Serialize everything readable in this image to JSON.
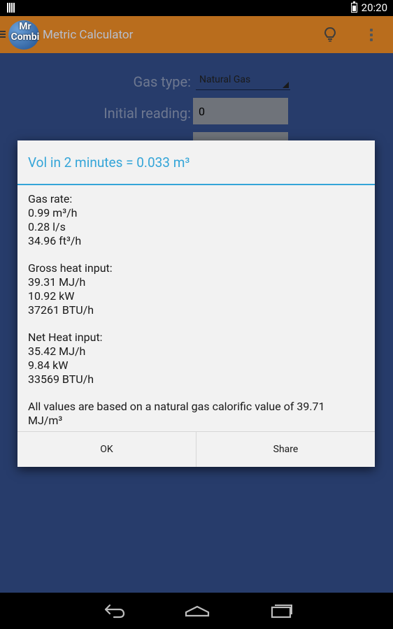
{
  "status": {
    "time": "20:20"
  },
  "app": {
    "title": "Metric Calculator",
    "logo_text_top": "Mr",
    "logo_text_bottom": "Combi"
  },
  "form": {
    "gas_type_label": "Gas type:",
    "gas_type_value": "Natural Gas",
    "initial_reading_label": "Initial reading:",
    "initial_reading_value": "0"
  },
  "dialog": {
    "title": "Vol in 2 minutes = 0.033 m³",
    "sections": [
      {
        "heading": "Gas rate:",
        "lines": [
          "0.99 m³/h",
          "0.28 l/s",
          "34.96 ft³/h"
        ]
      },
      {
        "heading": "Gross heat input:",
        "lines": [
          "39.31 MJ/h",
          "10.92 kW",
          "37261 BTU/h"
        ]
      },
      {
        "heading": "Net Heat input:",
        "lines": [
          "35.42 MJ/h",
          "9.84 kW",
          "33569 BTU/h"
        ]
      }
    ],
    "note": "All values are based on a natural gas calorific value of 39.71 MJ/m³",
    "ok_label": "OK",
    "share_label": "Share"
  },
  "icons": {
    "menu": "menu-icon",
    "bulb": "lightbulb-icon",
    "overflow": "overflow-menu-icon",
    "back": "back-icon",
    "home": "home-icon",
    "recents": "recents-icon"
  },
  "colors": {
    "accent": "#34a5d8",
    "app_bar": "#b96d1d",
    "background": "#273c6b",
    "dialog_bg": "#f2f2f2"
  }
}
